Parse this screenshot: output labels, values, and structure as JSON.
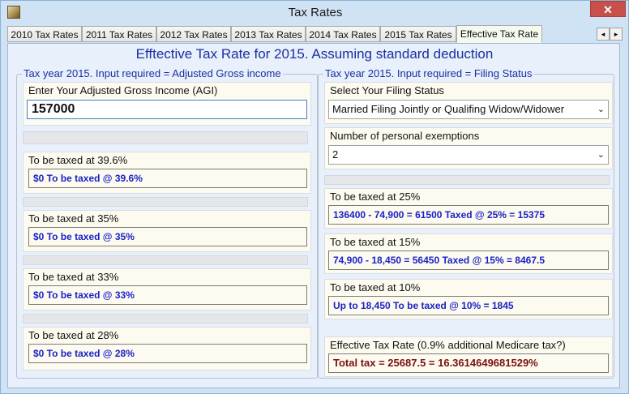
{
  "window": {
    "title": "Tax Rates",
    "close_label": "✕",
    "icon": "app-icon"
  },
  "tabs": [
    {
      "label": "2010 Tax Rates"
    },
    {
      "label": "2011 Tax Rates"
    },
    {
      "label": "2012 Tax Rates"
    },
    {
      "label": "2013 Tax Rates"
    },
    {
      "label": "2014 Tax Rates"
    },
    {
      "label": "2015 Tax Rates"
    },
    {
      "label": "Effective Tax Rate"
    }
  ],
  "tab_scroll": {
    "left": "◂",
    "right": "▸"
  },
  "heading": "Efftective Tax Rate for 2015. Assuming standard deduction",
  "left": {
    "legend": "Tax year 2015. Input required = Adjusted Gross income",
    "agi_label": "Enter Your Adjusted Gross Income (AGI)",
    "agi_value": "157000",
    "brackets": [
      {
        "label": "To be taxed at 39.6%",
        "value": "$0 To be taxed @ 39.6%"
      },
      {
        "label": "To be taxed at 35%",
        "value": "$0 To be taxed @ 35%"
      },
      {
        "label": "To be taxed at 33%",
        "value": "$0 To be taxed @ 33%"
      },
      {
        "label": "To be taxed at 28%",
        "value": "$0 To be taxed @ 28%"
      }
    ]
  },
  "right": {
    "legend": "Tax year 2015. Input required = Filing Status",
    "filing_label": "Select Your Filing Status",
    "filing_value": "Married Filing Jointly or Qualifing Widow/Widower",
    "exemptions_label": "Number of personal exemptions",
    "exemptions_value": "2",
    "brackets": [
      {
        "label": "To be taxed at 25%",
        "value": "136400 - 74,900 = 61500  Taxed @ 25% = 15375"
      },
      {
        "label": "To be taxed at 15%",
        "value": "74,900 - 18,450 = 56450  Taxed @ 15% = 8467.5"
      },
      {
        "label": "To be taxed at 10%",
        "value": "Up to 18,450 To be taxed @ 10% = 1845"
      }
    ],
    "effective_label": "Effective Tax Rate (0.9% additional Medicare tax?)",
    "effective_value": "Total tax = 25687.5 = 16.3614649681529%"
  },
  "colors": {
    "accent": "#1b2fa0",
    "value_text": "#1a22c8",
    "total_text": "#7a1010"
  }
}
